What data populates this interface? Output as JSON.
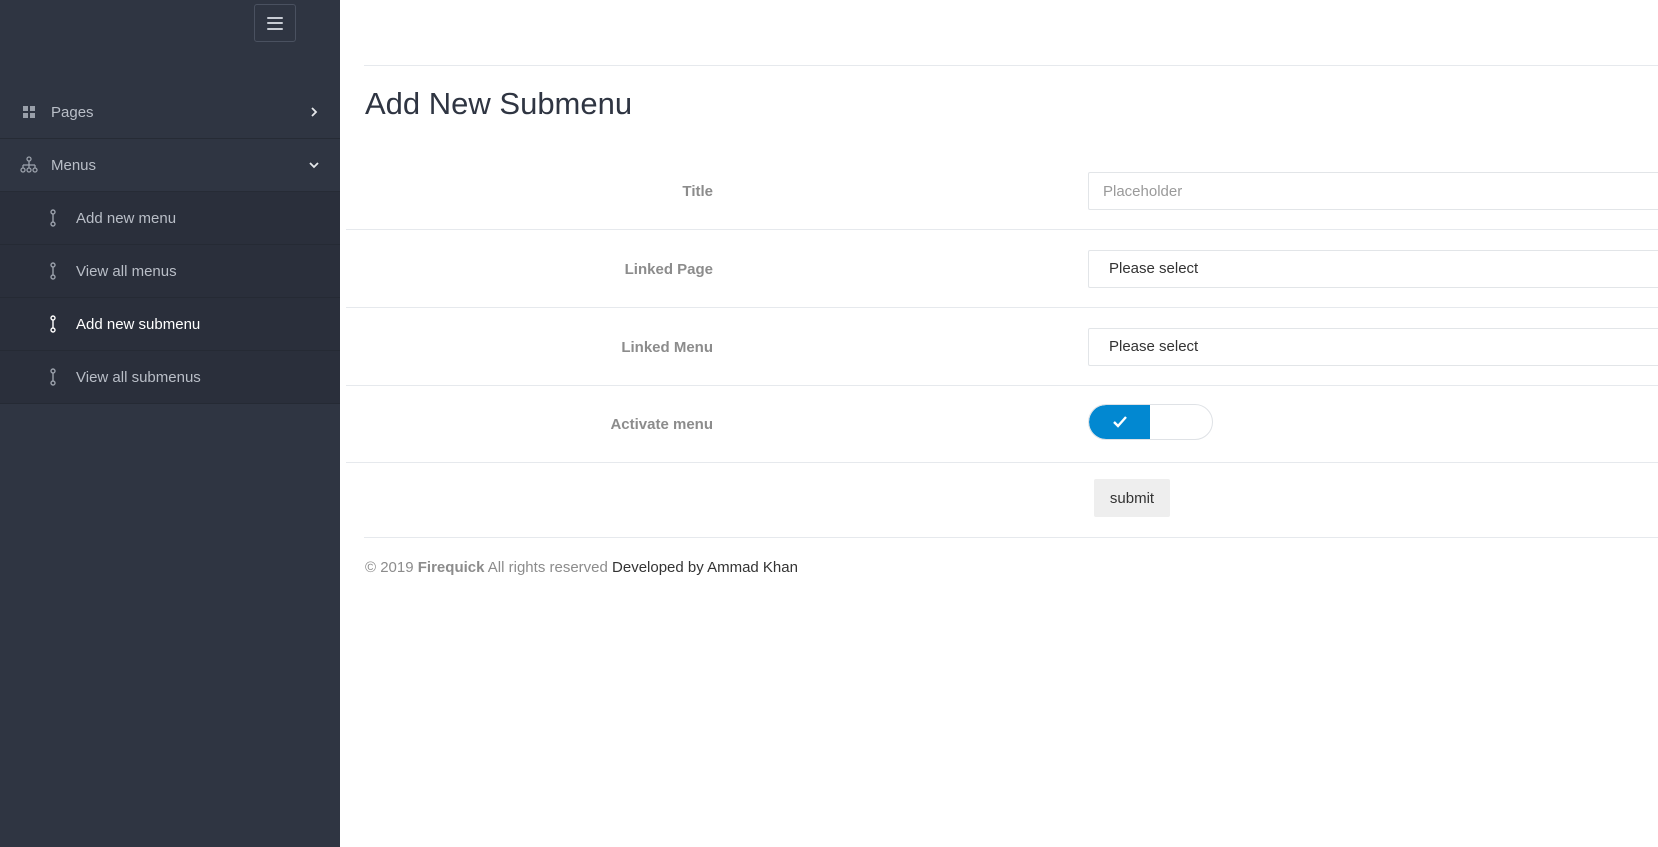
{
  "sidebar": {
    "toggle_icon": "hamburger-icon",
    "items": [
      {
        "label": "Pages",
        "icon": "grid-icon",
        "chevron": "chevron-right-icon"
      },
      {
        "label": "Menus",
        "icon": "sitemap-icon",
        "chevron": "chevron-down-icon"
      }
    ],
    "subitems": [
      {
        "label": "Add new menu",
        "icon": "link-icon",
        "active": false
      },
      {
        "label": "View all menus",
        "icon": "link-icon",
        "active": false
      },
      {
        "label": "Add new submenu",
        "icon": "link-icon",
        "active": true
      },
      {
        "label": "View all submenus",
        "icon": "link-icon",
        "active": false
      }
    ]
  },
  "main": {
    "title": "Add New Submenu",
    "form": {
      "title_label": "Title",
      "title_placeholder": "Placeholder",
      "title_value": "",
      "linked_page_label": "Linked Page",
      "linked_page_value": "Please select",
      "linked_menu_label": "Linked Menu",
      "linked_menu_value": "Please select",
      "activate_label": "Activate menu",
      "activate_on": true,
      "submit_label": "submit"
    }
  },
  "footer": {
    "prefix": "© 2019",
    "brand": "Firequick",
    "rights": "All rights reserved",
    "developer": "Developed by Ammad Khan"
  },
  "colors": {
    "sidebar_bg": "#2f3542",
    "accent": "#0288d1",
    "label_gray": "#8c8c8c"
  }
}
